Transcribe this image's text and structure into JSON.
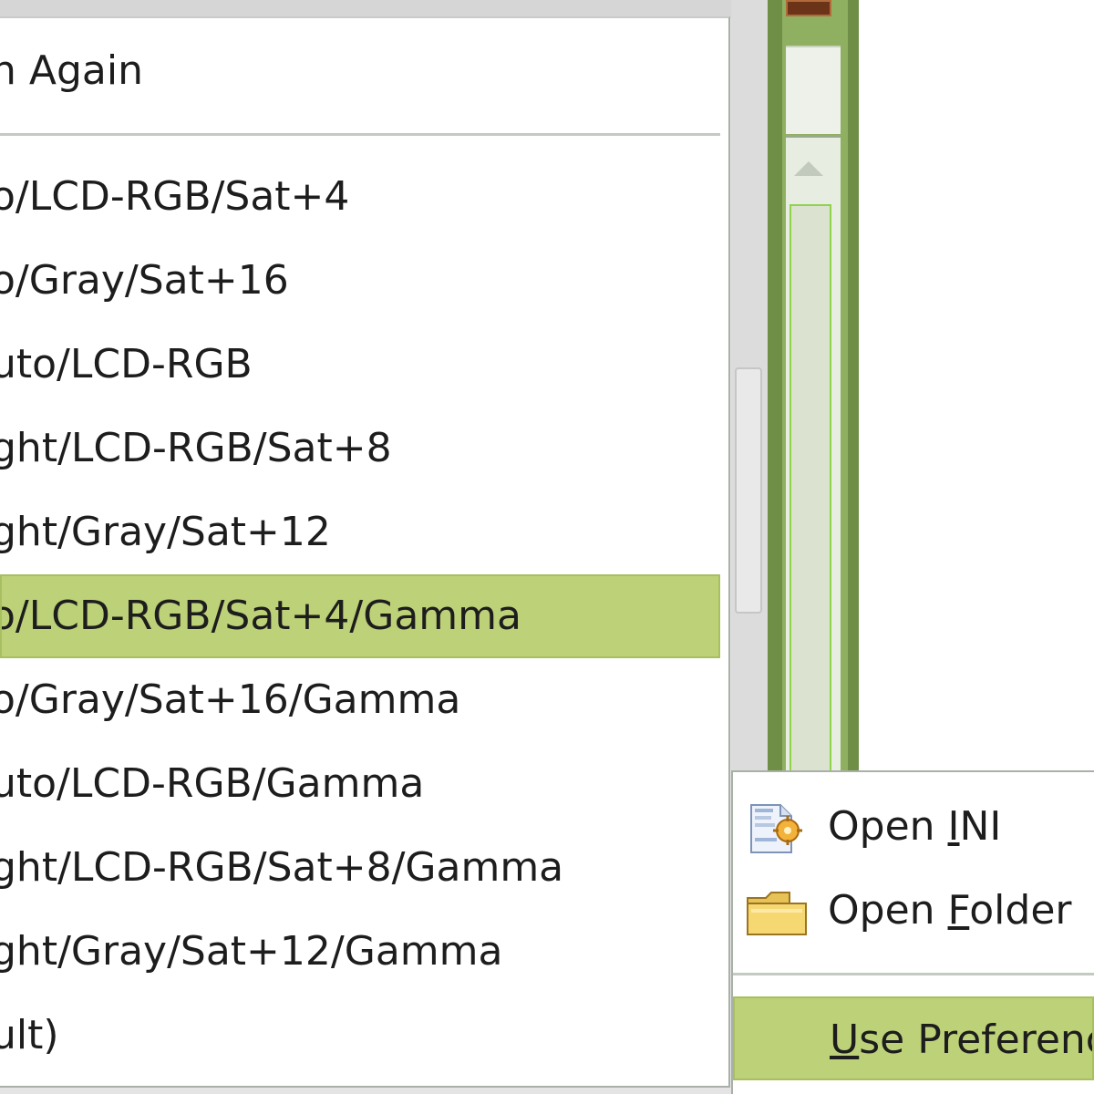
{
  "menu": {
    "search_again": {
      "before": "h Again"
    },
    "items": [
      "o/LCD-RGB/Sat+4",
      "o/Gray/Sat+16",
      "uto/LCD-RGB",
      "ght/LCD-RGB/Sat+8",
      "ght/Gray/Sat+12",
      "o/LCD-RGB/Sat+4/Gamma",
      "o/Gray/Sat+16/Gamma",
      "uto/LCD-RGB/Gamma",
      "ght/LCD-RGB/Sat+8/Gamma",
      "ght/Gray/Sat+12/Gamma",
      "ult)"
    ],
    "selected_index": 5
  },
  "submenu": {
    "open_ini": {
      "before": "Open ",
      "mnemonic": "I",
      "after": "NI",
      "icon": "ini-file-icon"
    },
    "open_folder": {
      "before": "Open ",
      "mnemonic": "F",
      "after": "older",
      "icon": "folder-icon"
    },
    "use_preferences": {
      "before": "",
      "mnemonic": "U",
      "after": "se Preferenc"
    }
  },
  "colors": {
    "highlight": "#bdd178",
    "frame_green": "#6f8f46"
  }
}
